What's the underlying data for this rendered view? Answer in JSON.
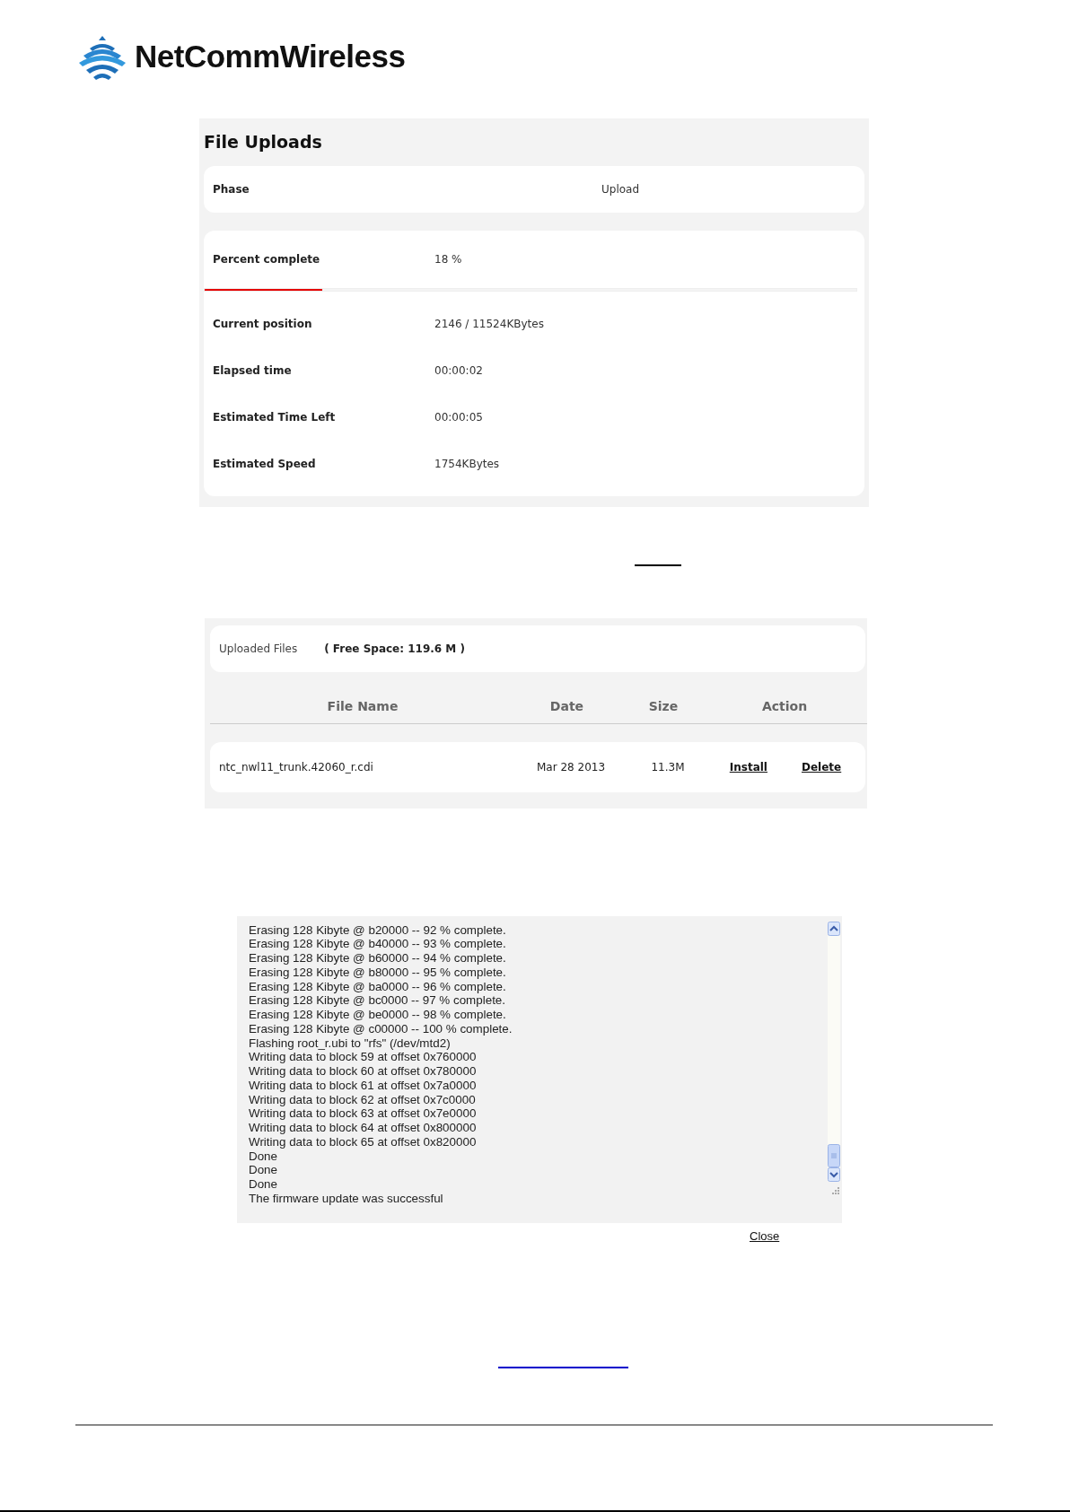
{
  "logo": {
    "text": "NetCommWireless"
  },
  "upload_panel": {
    "title": "File Uploads",
    "phase": {
      "label": "Phase",
      "value": "Upload"
    },
    "percent": {
      "label": "Percent complete",
      "value": "18 %",
      "level": 0.18
    },
    "rows": [
      {
        "label": "Current position",
        "value": "2146 / 11524KBytes"
      },
      {
        "label": "Elapsed time",
        "value": "00:00:02"
      },
      {
        "label": "Estimated Time Left",
        "value": "00:00:05"
      },
      {
        "label": "Estimated Speed",
        "value": "1754KBytes"
      }
    ]
  },
  "files_panel": {
    "title": "Uploaded Files",
    "free_space": "( Free Space: 119.6 M )",
    "columns": [
      "File Name",
      "Date",
      "Size",
      "Action"
    ],
    "rows": [
      {
        "name": "ntc_nwl11_trunk.42060_r.cdi",
        "date": "Mar 28 2013",
        "size": "11.3M",
        "actions": [
          "Install",
          "Delete"
        ]
      }
    ]
  },
  "log": {
    "lines": [
      "Erasing 128 Kibyte @ b20000 -- 92 % complete.",
      "Erasing 128 Kibyte @ b40000 -- 93 % complete.",
      "Erasing 128 Kibyte @ b60000 -- 94 % complete.",
      "Erasing 128 Kibyte @ b80000 -- 95 % complete.",
      "Erasing 128 Kibyte @ ba0000 -- 96 % complete.",
      "Erasing 128 Kibyte @ bc0000 -- 97 % complete.",
      "Erasing 128 Kibyte @ be0000 -- 98 % complete.",
      "Erasing 128 Kibyte @ c00000 -- 100 % complete.",
      "Flashing root_r.ubi to \"rfs\" (/dev/mtd2)",
      "Writing data to block 59 at offset 0x760000",
      "Writing data to block 60 at offset 0x780000",
      "Writing data to block 61 at offset 0x7a0000",
      "Writing data to block 62 at offset 0x7c0000",
      "Writing data to block 63 at offset 0x7e0000",
      "Writing data to block 64 at offset 0x800000",
      "Writing data to block 65 at offset 0x820000",
      "Done",
      "Done",
      "Done",
      "The firmware update was successful"
    ],
    "close": "Close"
  }
}
